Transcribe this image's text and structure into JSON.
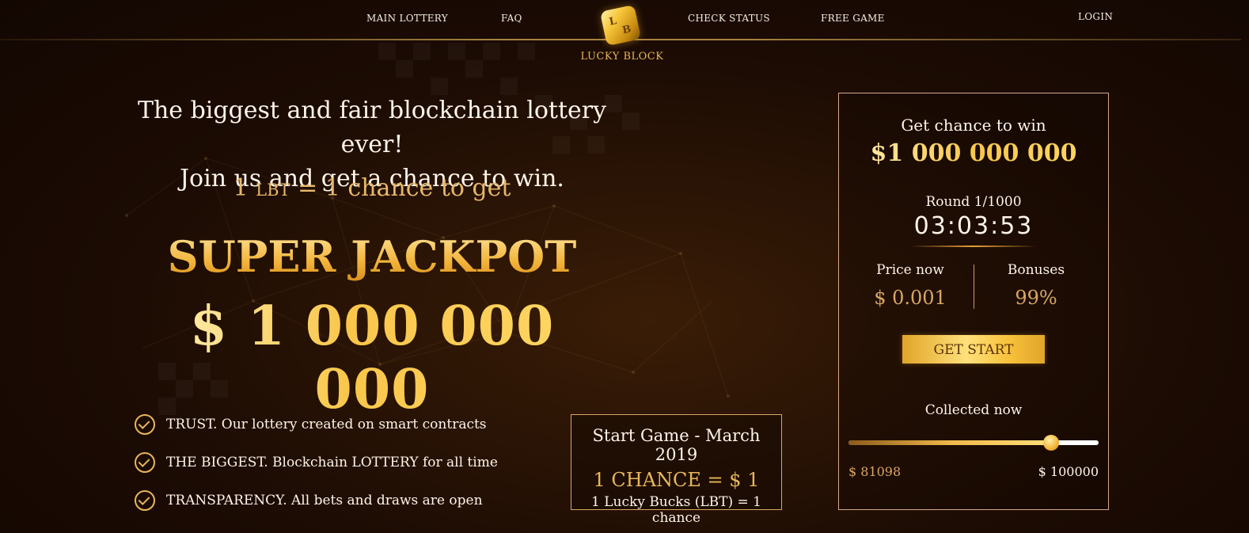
{
  "nav": {
    "items": [
      "MAIN LOTTERY",
      "FAQ",
      "CHECK STATUS",
      "FREE GAME"
    ],
    "login": "LOGIN",
    "logo_text": "LUCKY BLOCK",
    "logo_mark": [
      "L",
      "B"
    ]
  },
  "hero": {
    "title_line1": "The biggest and fair blockchain lottery ever!",
    "title_line2": "Join us and get a chance to win.",
    "lbt_num": "1",
    "lbt_unit": "LBT",
    "lbt_eq": "= 1",
    "lbt_rest": "chance to get",
    "super_jackpot": "SUPER JACKPOT",
    "jackpot_amount": "$ 1 000 000 000"
  },
  "features": [
    {
      "text": "TRUST. Our lottery created on smart contracts"
    },
    {
      "text": "THE BIGGEST. Blockchain LOTTERY for all time"
    },
    {
      "text": "TRANSPARENCY. All bets and draws are open"
    }
  ],
  "start_box": {
    "title": "Start Game - March 2019",
    "chance": "1 CHANCE = $ 1",
    "lbt": "1 Lucky Bucks (LBT) = 1 chance"
  },
  "panel": {
    "title": "Get chance to win",
    "amount": "$1 000 000 000",
    "round": "Round 1/1000",
    "timer": "03:03:53",
    "price_label": "Price now",
    "price_value": "$ 0.001",
    "bonus_label": "Bonuses",
    "bonus_value": "99%",
    "button": "GET START",
    "collected_label": "Collected now",
    "collected_fraction": 0.81098,
    "min_value": "$ 81098",
    "max_value": "$ 100000"
  },
  "colors": {
    "gold": "#e8b65a",
    "background": "#1b0b03",
    "panel_border": "#d7a98a"
  }
}
